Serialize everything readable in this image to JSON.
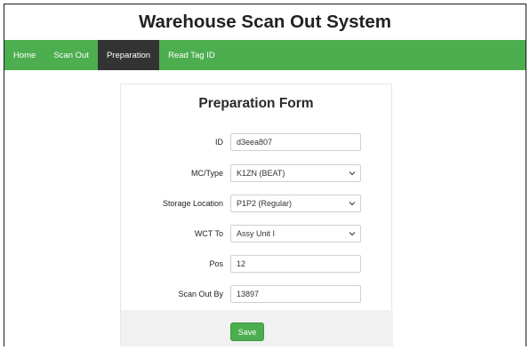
{
  "app": {
    "title": "Warehouse Scan Out System"
  },
  "nav": {
    "items": [
      {
        "label": "Home"
      },
      {
        "label": "Scan Out"
      },
      {
        "label": "Preparation",
        "active": true
      },
      {
        "label": "Read Tag ID"
      }
    ]
  },
  "form": {
    "title": "Preparation Form",
    "fields": {
      "id": {
        "label": "ID",
        "value": "d3eea807"
      },
      "mc_type": {
        "label": "MC/Type",
        "value": "K1ZN (BEAT)"
      },
      "storage_location": {
        "label": "Storage Location",
        "value": "P1P2 (Regular)"
      },
      "wct_to": {
        "label": "WCT To",
        "value": "Assy Unit I"
      },
      "pos": {
        "label": "Pos",
        "value": "12"
      },
      "scan_out_by": {
        "label": "Scan Out By",
        "value": "13897"
      }
    },
    "save_label": "Save"
  },
  "colors": {
    "nav_bg": "#4cae4f",
    "nav_active_bg": "#333333",
    "save_bg": "#4cae4f"
  },
  "icons": {
    "select_chevron": "chevron-down-icon"
  }
}
